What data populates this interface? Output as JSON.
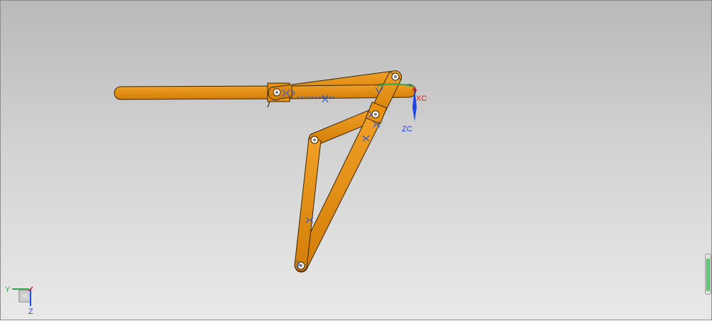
{
  "view_triad": {
    "axis_y_label": "Y",
    "axis_z_label": "Z",
    "axis_x_label": "X"
  },
  "csys": {
    "xc_label": "XC",
    "zc_label": "ZC"
  },
  "colors": {
    "part_fill": "#e38a0d",
    "part_outline": "#3a2608",
    "constraint_symbol": "#2b57d8",
    "xc_axis": "#d62020",
    "zc_axis": "#1e46e0",
    "yc_axis": "#2fa84f",
    "scrollbar_thumb": "#4fcc5f"
  },
  "icons": [
    "view-triad-icon",
    "work-csys-icon",
    "constraint-icon",
    "pin-joint-icon"
  ]
}
